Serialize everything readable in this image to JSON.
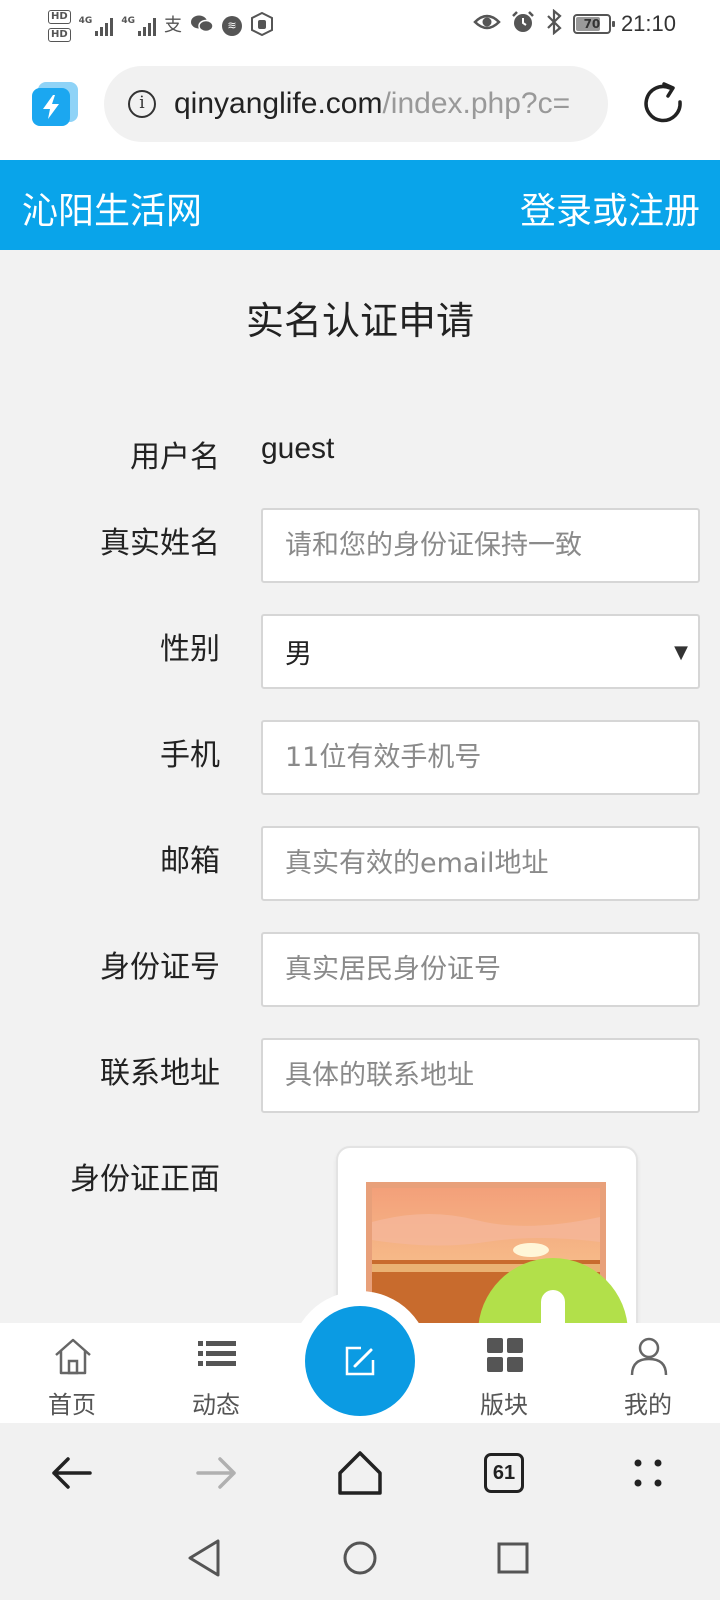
{
  "status_bar": {
    "hd_badge_1": "HD",
    "hd_badge_2": "HD",
    "net_type_1": "4G",
    "net_type_2": "4G",
    "battery_level": "70",
    "time": "21:10"
  },
  "browser": {
    "url_host": "qinyanglife.com",
    "url_path": "/index.php?c=",
    "tab_count": "61"
  },
  "site": {
    "name": "沁阳生活网",
    "login_label": "登录或注册",
    "accent_color": "#09a4ea"
  },
  "form": {
    "title": "实名认证申请",
    "username_label": "用户名",
    "username_value": "guest",
    "realname_label": "真实姓名",
    "realname_placeholder": "请和您的身份证保持一致",
    "gender_label": "性别",
    "gender_value": "男",
    "phone_label": "手机",
    "phone_placeholder": "11位有效手机号",
    "email_label": "邮箱",
    "email_placeholder": "真实有效的email地址",
    "idnumber_label": "身份证号",
    "idnumber_placeholder": "真实居民身份证号",
    "address_label": "联系地址",
    "address_placeholder": "具体的联系地址",
    "idfront_label": "身份证正面"
  },
  "bottom_nav": {
    "home": "首页",
    "feed": "动态",
    "boards": "版块",
    "mine": "我的"
  },
  "icons": {
    "browser_logo": "lightning-icon",
    "info": "info-icon",
    "reload": "reload-icon",
    "home": "house-icon",
    "feed": "list-icon",
    "post": "edit-icon",
    "boards": "grid-icon",
    "mine": "user-icon"
  }
}
